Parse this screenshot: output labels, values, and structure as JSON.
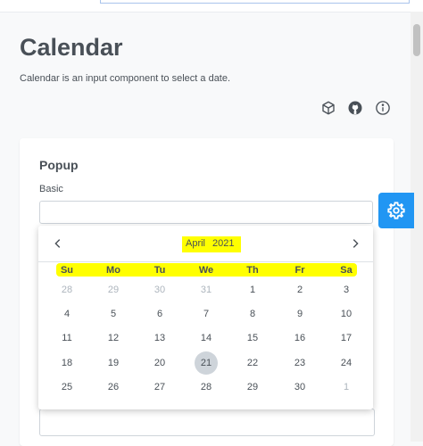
{
  "header": {
    "title": "Calendar",
    "description": "Calendar is an input component to select a date.",
    "icons": [
      "box-icon",
      "github-icon",
      "info-icon"
    ]
  },
  "card": {
    "title": "Popup",
    "subtitle": "Basic",
    "input_value": ""
  },
  "config_button": {
    "icon": "gear-icon",
    "color": "#2196f3"
  },
  "calendar": {
    "month": "April",
    "year": "2021",
    "prev_icon": "chevron-left-icon",
    "next_icon": "chevron-right-icon",
    "weekdays": [
      "Su",
      "Mo",
      "Tu",
      "We",
      "Th",
      "Fr",
      "Sa"
    ],
    "weeks": [
      [
        {
          "d": "28",
          "other": true
        },
        {
          "d": "29",
          "other": true
        },
        {
          "d": "30",
          "other": true
        },
        {
          "d": "31",
          "other": true
        },
        {
          "d": "1"
        },
        {
          "d": "2"
        },
        {
          "d": "3"
        }
      ],
      [
        {
          "d": "4"
        },
        {
          "d": "5"
        },
        {
          "d": "6"
        },
        {
          "d": "7"
        },
        {
          "d": "8"
        },
        {
          "d": "9"
        },
        {
          "d": "10"
        }
      ],
      [
        {
          "d": "11"
        },
        {
          "d": "12"
        },
        {
          "d": "13"
        },
        {
          "d": "14"
        },
        {
          "d": "15"
        },
        {
          "d": "16"
        },
        {
          "d": "17"
        }
      ],
      [
        {
          "d": "18"
        },
        {
          "d": "19"
        },
        {
          "d": "20"
        },
        {
          "d": "21",
          "selected": true
        },
        {
          "d": "22"
        },
        {
          "d": "23"
        },
        {
          "d": "24"
        }
      ],
      [
        {
          "d": "25"
        },
        {
          "d": "26"
        },
        {
          "d": "27"
        },
        {
          "d": "28"
        },
        {
          "d": "29"
        },
        {
          "d": "30"
        },
        {
          "d": "1",
          "other": true
        }
      ]
    ],
    "highlight_color": "#ffff00",
    "selected_color": "#ced4da"
  }
}
